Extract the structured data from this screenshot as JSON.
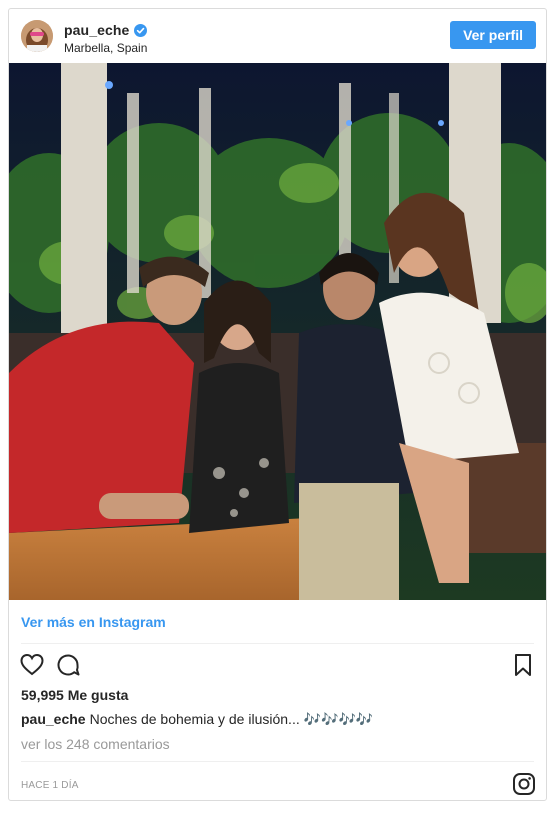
{
  "post": {
    "username": "pau_eche",
    "location": "Marbella, Spain",
    "view_profile_label": "Ver perfil",
    "more_link_label": "Ver más en Instagram",
    "likes_text": "59,995 Me gusta",
    "caption_user": "pau_eche",
    "caption_text": "Noches de bohemia y de ilusión... 🎶🎶🎶🎶",
    "comments_link": "ver los 248 comentarios",
    "timestamp": "HACE 1 DÍA"
  },
  "icons": {
    "verified": "verified-badge-icon",
    "like": "heart-icon",
    "comment": "comment-icon",
    "save": "bookmark-icon",
    "brand": "instagram-icon"
  },
  "colors": {
    "accent": "#3897f0",
    "text": "#262626",
    "muted": "#999999",
    "border": "#dbdbdb"
  }
}
